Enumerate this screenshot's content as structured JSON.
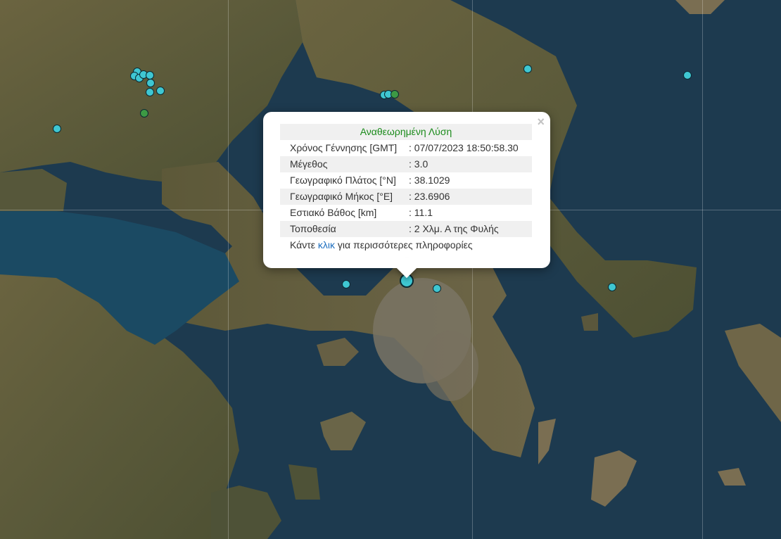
{
  "popup": {
    "title": "Αναθεωρημένη Λύση",
    "rows": [
      {
        "label": "Χρόνος Γέννησης [GMT]",
        "value": ": 07/07/2023 18:50:58.30"
      },
      {
        "label": "Μέγεθος",
        "value": ": 3.0"
      },
      {
        "label": "Γεωγραφικό Πλάτος [°N]",
        "value": ": 38.1029"
      },
      {
        "label": "Γεωγραφικό Μήκος [°E]",
        "value": ": 23.6906"
      },
      {
        "label": "Εστιακό Βάθος [km]",
        "value": ": 11.1"
      },
      {
        "label": "Τοποθεσία",
        "value": ": 2 Χλμ. Α της Φυλής"
      }
    ],
    "more_prefix": "Κάντε ",
    "more_link": "κλικ",
    "more_suffix": " για περισσότερες πληροφορίες",
    "close_symbol": "×"
  },
  "colors": {
    "quake_cyan": "#3fc7d2",
    "quake_green": "#3d9a44",
    "sea": "#1d3a4f",
    "land": "#5e5a3e"
  },
  "icons": {
    "close": "close-icon",
    "selected_event": "earthquake-marker-selected"
  }
}
